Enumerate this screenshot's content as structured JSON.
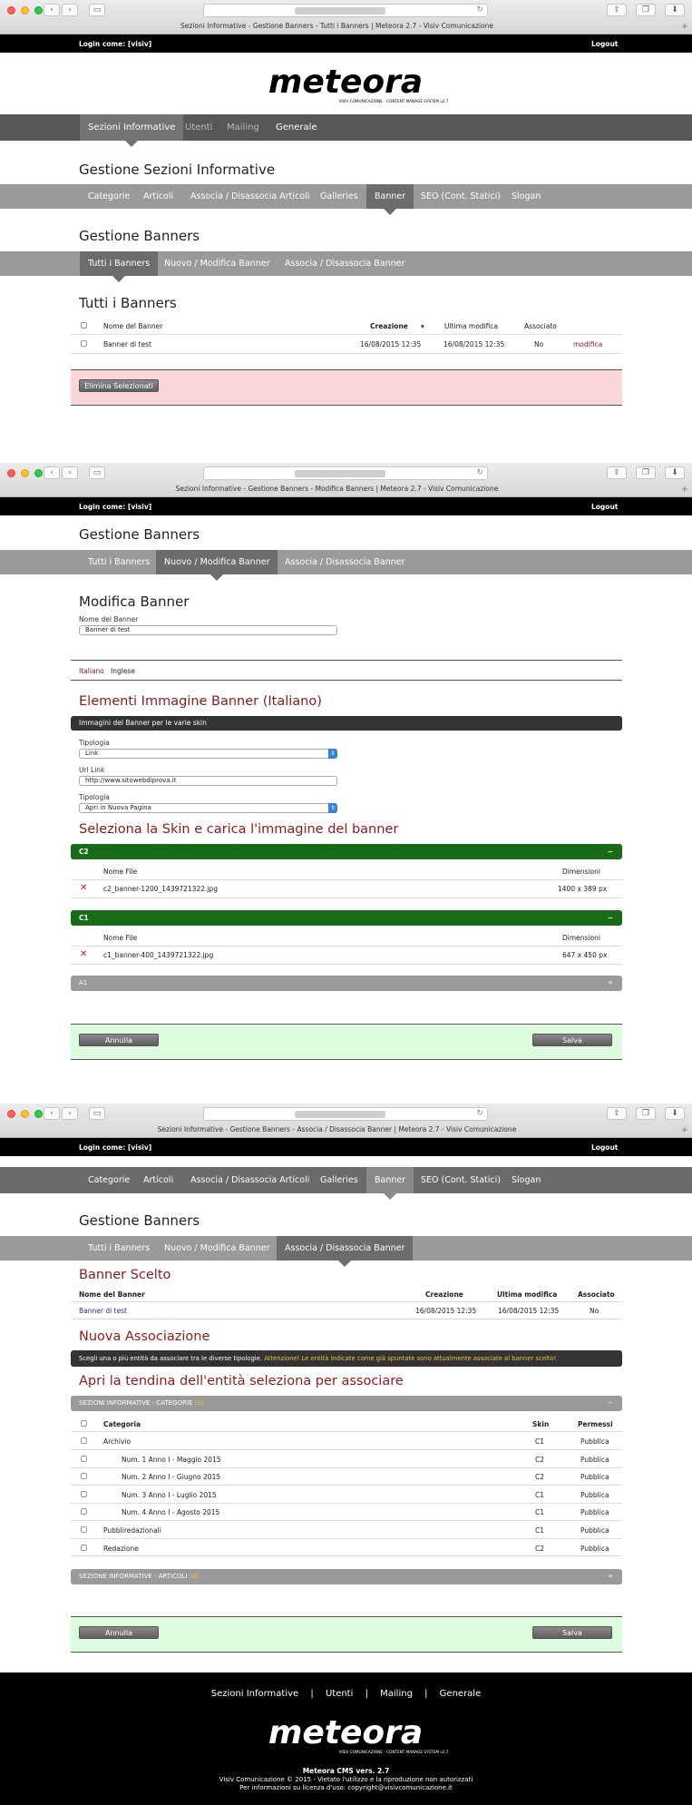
{
  "window1": {
    "tab_title": "Sezioni Informative - Gestione Banners - Tutti i Banners | Meteora 2.7 - Visiv Comunicazione"
  },
  "window2": {
    "tab_title": "Sezioni Informative - Gestione Banners - Modifica Banners | Meteora 2.7 - Visiv Comunicazione"
  },
  "window3": {
    "tab_title": "Sezioni Informative - Gestione Banners - Associa / Disassocia Banner | Meteora 2.7 - Visiv Comunicazione"
  },
  "login": {
    "label": "Login come: [visiv]",
    "logout": "Logout"
  },
  "logo": {
    "text": "meteora",
    "tagline": "VISIV COMUNICAZIONE - CONTENT MANAGE SYSTEM v2.7"
  },
  "main_nav": [
    "Sezioni Informative",
    "Utenti",
    "Mailing",
    "Generale"
  ],
  "section_title": "Gestione Sezioni Informative",
  "section_nav": [
    "Categorie",
    "Articoli",
    "Associa / Disassocia Articoli",
    "Galleries",
    "Banner",
    "SEO (Cont. Statici)",
    "Slogan"
  ],
  "banners_title": "Gestione Banners",
  "banners_nav": [
    "Tutti i Banners",
    "Nuovo / Modifica Banner",
    "Associa / Disassocia Banner"
  ],
  "list": {
    "title": "Tutti i Banners",
    "headers": {
      "name": "Nome del Banner",
      "created": "Creazione",
      "modified": "Ultima modifica",
      "associated": "Associato"
    },
    "rows": [
      {
        "name": "Banner di test",
        "created": "16/08/2015 12:35",
        "modified": "16/08/2015 12:35",
        "associated": "No",
        "action": "modifica"
      }
    ],
    "delete_button": "Elimina Selezionati"
  },
  "edit": {
    "title": "Modifica Banner",
    "name_label": "Nome del Banner",
    "name_value": "Banner di test",
    "languages": [
      "Italiano",
      "Inglese"
    ],
    "images_title": "Elementi Immagine Banner (Italiano)",
    "images_bar": "Immagini del Banner per le varie skin",
    "tipologia_label": "Tipologia",
    "tipologia_value": "Link",
    "url_label": "Url Link",
    "url_value": "http://www.sitowebdiprova.it",
    "tipologia2_label": "Tipologia",
    "tipologia2_value": "Apri in Nuova Pagina",
    "skin_title": "Seleziona la Skin e carica l'immagine del banner",
    "file_header": "Nome File",
    "dim_header": "Dimensioni",
    "skins": [
      {
        "name": "C2",
        "sign": "−",
        "file": "c2_banner-1200_1439721322.jpg",
        "dim": "1400 x 389 px"
      },
      {
        "name": "C1",
        "sign": "−",
        "file": "c1_banner-400_1439721322.jpg",
        "dim": "647 x 450 px"
      },
      {
        "name": "A1",
        "sign": "+"
      }
    ],
    "cancel": "Annulla",
    "save": "Salva"
  },
  "assoc": {
    "chosen_title": "Banner Scelto",
    "headers": {
      "name": "Nome del Banner",
      "created": "Creazione",
      "modified": "Ultima modifica",
      "associated": "Associato"
    },
    "row": {
      "name": "Banner di test",
      "created": "16/08/2015 12:35",
      "modified": "16/08/2015 12:35",
      "associated": "No"
    },
    "new_title": "Nuova Associazione",
    "note_white": "Scegli una o più entità da associare tra le diverse tipologie.",
    "note_yellow": "Attenzione! Le entità indicate come già spuntate sono attualmente associate al banner scelto!",
    "dropdown_title": "Apri la tendina dell'entità seleziona per associare",
    "cat_bar": "SEZIONI INFORMATIVE - CATEGORIE",
    "cat_count": "(0)",
    "cat_headers": {
      "category": "Categoria",
      "skin": "Skin",
      "perm": "Permessi"
    },
    "categories": [
      {
        "name": "Archivio",
        "skin": "C1",
        "perm": "Pubblica"
      },
      {
        "name": "Num. 1 Anno I - Maggio 2015",
        "skin": "C2",
        "perm": "Pubblica"
      },
      {
        "name": "Num. 2 Anno I - Giugno 2015",
        "skin": "C2",
        "perm": "Pubblica"
      },
      {
        "name": "Num. 3 Anno I - Luglio 2015",
        "skin": "C1",
        "perm": "Pubblica"
      },
      {
        "name": "Num. 4 Anno I - Agosto 2015",
        "skin": "C1",
        "perm": "Pubblica"
      },
      {
        "name": "Pubbliredazionali",
        "skin": "C1",
        "perm": "Pubblica"
      },
      {
        "name": "Redazione",
        "skin": "C2",
        "perm": "Pubblica"
      }
    ],
    "art_bar": "SEZIONE INFORMATIVE - ARTICOLI",
    "art_count": "(0)",
    "art_sign": "+",
    "cancel": "Annulla",
    "save": "Salva"
  },
  "footer": {
    "nav": [
      "Sezioni Informative",
      "Utenti",
      "Mailing",
      "Generale"
    ],
    "separator": "|",
    "version": "Meteora CMS vers. 2.7",
    "copyright": "Visiv Comunicazione © 2015 - Vietato l'utilizzo e la riproduzione non autorizzati",
    "license": "Per informazioni su licenza d'uso: copyright@visivcomunicazione.it"
  },
  "colors": {
    "accent_red": "#8b1a1a",
    "skin_green": "#186c18",
    "nav_dark": "#575757",
    "pink_panel": "#fdd6d9",
    "green_panel": "#ddfbdd",
    "note_yellow": "#f0c040"
  }
}
